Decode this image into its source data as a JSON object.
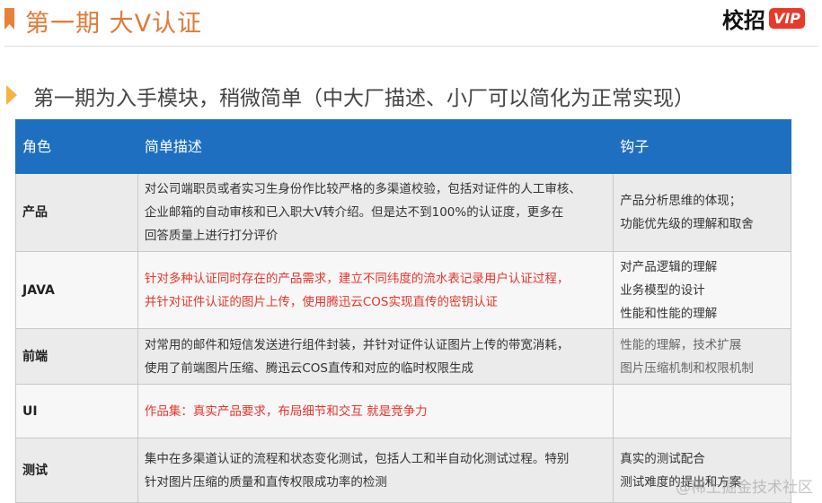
{
  "header": {
    "title": "第一期  大V认证",
    "logo_text": "校招",
    "logo_badge": "VIP"
  },
  "subtitle": "第一期为入手模块，稍微简单（中大厂描述、小厂可以简化为正常实现）",
  "table": {
    "headers": [
      "角色",
      "简单描述",
      "钩子"
    ],
    "rows": [
      {
        "role": "产品",
        "desc": [
          "对公司端职员或者实习生身份作比较严格的多渠道校验，包括对证件的人工审核、",
          "企业邮箱的自动审核和已入职大V转介绍。但是达不到100%的认证度，更多在",
          "回答质量上进行打分评价"
        ],
        "hook": [
          "产品分析思维的体现；",
          "功能优先级的理解和取舍"
        ]
      },
      {
        "role": "JAVA",
        "desc": [
          "针对多种认证同时存在的产品需求，建立不同纬度的流水表记录用户认证过程，",
          "并针对证件认证的图片上传，使用腾迅云COS实现直传的密钥认证"
        ],
        "hook": [
          "对产品逻辑的理解",
          "业务模型的设计",
          "性能和性能的理解"
        ]
      },
      {
        "role": "前端",
        "desc": [
          "对常用的邮件和短信发送进行组件封装，并针对证件认证图片上传的带宽消耗，",
          "使用了前端图片压缩、腾迅云COS直传和对应的临时权限生成"
        ],
        "hook": [
          "性能的理解，技术扩展",
          "图片压缩机制和权限机制"
        ]
      },
      {
        "role": "UI",
        "desc": [
          "作品集：真实产品要求，布局细节和交互 就是竞争力"
        ],
        "hook": []
      },
      {
        "role": "测试",
        "desc": [
          "集中在多渠道认证的流程和状态变化测试，包括人工和半自动化测试过程。特别",
          "针对图片压缩的质量和直传权限成功率的检测"
        ],
        "hook": [
          "真实的测试配合",
          "测试难度的提出和方案"
        ]
      }
    ]
  },
  "watermark": "@稀土掘金技术社区",
  "colors": {
    "accent": "#e07b39",
    "header_bg": "#1f6fc0",
    "red_text": "#e8352c"
  }
}
